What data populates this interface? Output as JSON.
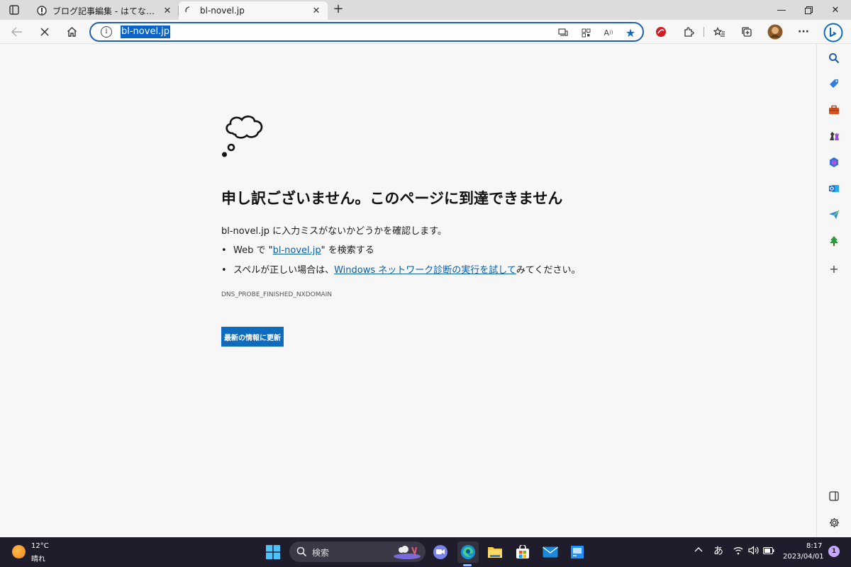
{
  "tabs": [
    {
      "title": "ブログ記事編集 - はてなブログ",
      "active": false
    },
    {
      "title": "bl-novel.jp",
      "active": true
    }
  ],
  "address_bar": {
    "url": "bl-novel.jp"
  },
  "error_page": {
    "heading": "申し訳ございません。このページに到達できません",
    "check_prefix": "bl-novel.jp",
    "check_suffix": " に入力ミスがないかどうかを確認します。",
    "bullet1_prefix": "Web で \"",
    "bullet1_link": "bl-novel.jp",
    "bullet1_suffix": "\" を検索する",
    "bullet2_prefix": "スペルが正しい場合は、",
    "bullet2_link": "Windows ネットワーク診断の実行を試して",
    "bullet2_suffix": "みてください。",
    "error_code": "DNS_PROBE_FINISHED_NXDOMAIN",
    "refresh_label": "最新の情報に更新"
  },
  "taskbar": {
    "weather_temp": "12°C",
    "weather_condition": "晴れ",
    "search_label": "検索",
    "ime": "あ",
    "time": "8:17",
    "date": "2023/04/01",
    "notification_count": "1"
  },
  "colors": {
    "accent": "#0f6cbd",
    "link": "#0b5ea8",
    "taskbar": "#1f1d2b"
  }
}
